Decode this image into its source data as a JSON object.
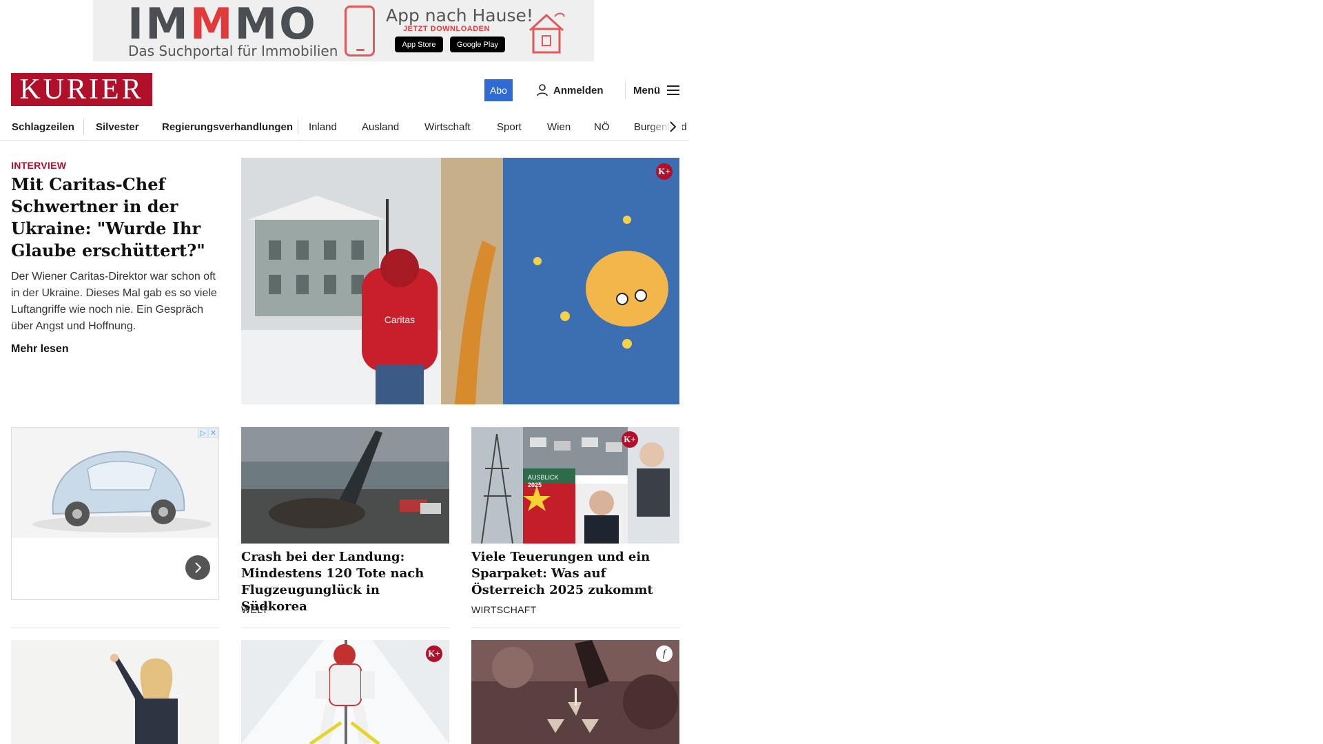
{
  "banner": {
    "brand_prefix": "IM",
    "brand_red": "M",
    "brand_suffix": "MO",
    "tagline": "Das Suchportal für Immobilien",
    "headline": "App nach Hause!",
    "cta": "JETZT DOWNLOADEN",
    "store_apple": "App Store",
    "store_google": "Google Play"
  },
  "header": {
    "logo": "KURIER",
    "abo": "Abo",
    "login": "Anmelden",
    "menu": "Menü"
  },
  "nav": {
    "items": [
      "Schlagzeilen",
      "Silvester",
      "Regierungsverhandlungen",
      "Inland",
      "Ausland",
      "Wirtschaft",
      "Sport",
      "Wien",
      "NÖ",
      "Burgenland"
    ]
  },
  "lead": {
    "kicker": "INTERVIEW",
    "title": "Mit Caritas-Chef Schwertner in der Ukraine: \"Wurde Ihr Glaube erschüttert?\"",
    "teaser": "Der Wiener Caritas-Direktor war schon oft in der Ukraine. Dieses Mal gab es so viele Luftangriffe wie noch nie. Ein Gespräch über Angst und Hoffnung.",
    "read_more": "Mehr lesen",
    "badge": "K+",
    "jacket_text": "Caritas"
  },
  "cards": [
    {
      "title": "Crash bei der Landung: Mindestens 120 Tote nach Flugzeugunglück in Südkorea",
      "category": "WELT"
    },
    {
      "title": "Viele Teuerungen und ein Sparpa­ket: Was auf Österreich 2025 zukommt",
      "category": "WIRTSCHAFT",
      "badge": "K+",
      "image_label_1": "AUSBLICK",
      "image_label_2": "2025"
    }
  ],
  "row3": {
    "badge_ski": "K+",
    "badge_champagne": "f"
  },
  "colors": {
    "brand_red": "#b0102a",
    "abo_blue": "#2f6bd3"
  }
}
